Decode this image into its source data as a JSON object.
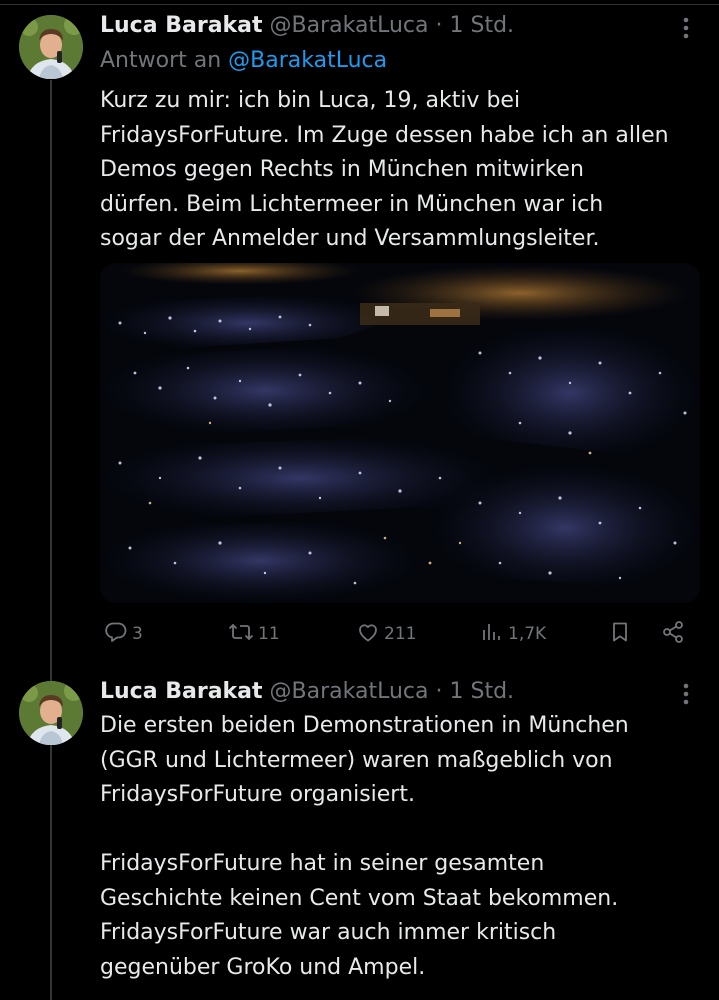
{
  "tweets": [
    {
      "author_name": "Luca Barakat",
      "handle": "@BarakatLuca",
      "separator": "·",
      "time": "1 Std.",
      "reply_prefix": "Antwort an",
      "reply_handle": "@BarakatLuca",
      "text_lines": [
        "Kurz zu mir: ich bin Luca, 19, aktiv bei",
        "FridaysForFuture. Im Zuge dessen habe ich an allen",
        "Demos gegen Rechts in München mitwirken",
        "dürfen. Beim Lichtermeer in München war ich",
        "sogar der Anmelder und Versammlungsleiter."
      ],
      "stats": {
        "replies": "3",
        "reposts": "11",
        "likes": "211",
        "views": "1,7K"
      }
    },
    {
      "author_name": "Luca Barakat",
      "handle": "@BarakatLuca",
      "separator": "·",
      "time": "1 Std.",
      "paragraph1": [
        "Die ersten beiden Demonstrationen in München",
        "(GGR und Lichtermeer) waren maßgeblich von",
        "FridaysForFuture organisiert."
      ],
      "paragraph2": [
        "FridaysForFuture hat in seiner gesamten",
        "Geschichte keinen Cent vom Staat bekommen.",
        "FridaysForFuture war auch immer kritisch",
        "gegenüber GroKo und Ampel."
      ]
    }
  ],
  "icons": {
    "reply": "reply-icon",
    "repost": "repost-icon",
    "like": "heart-icon",
    "views": "views-icon",
    "bookmark": "bookmark-icon",
    "share": "share-icon",
    "more": "more-icon"
  },
  "colors": {
    "background": "#000000",
    "text": "#e7e9ea",
    "muted": "#71767b",
    "link": "#1d9bf0",
    "thread_line": "#333639"
  }
}
